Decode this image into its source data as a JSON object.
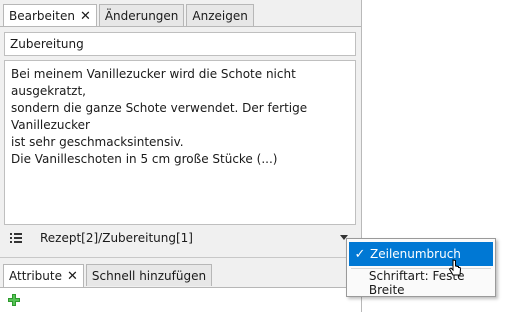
{
  "editor": {
    "tabs": [
      {
        "label": "Bearbeiten",
        "close": "✕"
      },
      {
        "label": "Änderungen"
      },
      {
        "label": "Anzeigen"
      }
    ],
    "title_value": "Zubereitung",
    "body_text": "Bei meinem Vanillezucker wird die Schote nicht ausgekratzt,\nsondern die ganze Schote verwendet. Der fertige Vanillezucker\nist sehr geschmacksintensiv.\nDie Vanilleschoten in 5 cm große Stücke (...)",
    "path": "Rezept[2]/Zubereitung[1]"
  },
  "lower_panel": {
    "tabs": [
      {
        "label": "Attribute",
        "close": "✕"
      },
      {
        "label": "Schnell hinzufügen"
      }
    ]
  },
  "context_menu": {
    "items": [
      {
        "check": "✓",
        "label": "Zeilenumbruch"
      },
      {
        "label": "Schriftart: Feste Breite"
      }
    ]
  },
  "colors": {
    "selection": "#0078d4",
    "add_icon": "#2e9a2e"
  }
}
